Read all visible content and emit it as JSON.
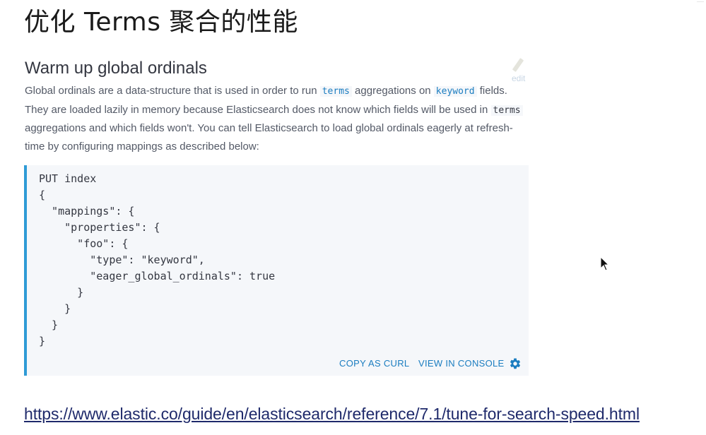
{
  "slide": {
    "title": "优化 Terms 聚合的性能"
  },
  "doc": {
    "heading": "Warm up global ordinals",
    "edit_label": "edit",
    "paragraph": {
      "p1": "Global ordinals are a data-structure that is used in order to run ",
      "code_terms_link": "terms",
      "p2": " aggregations on ",
      "code_keyword_link": "keyword",
      "p3": " fields. They are loaded lazily in memory because Elasticsearch does not know which fields will be used in ",
      "code_terms": "terms",
      "p4": " aggregations and which fields won't. You can tell Elasticsearch to load global ordinals eagerly at refresh-time by configuring mappings as described below:"
    },
    "code_lines": [
      "PUT index",
      "{",
      "  \"mappings\": {",
      "    \"properties\": {",
      "      \"foo\": {",
      "        \"type\": \"keyword\",",
      "        \"eager_global_ordinals\": true",
      "      }",
      "    }",
      "  }",
      "}"
    ],
    "copy_as_curl": "COPY AS CURL",
    "view_in_console": "VIEW IN CONSOLE"
  },
  "reference_url": "https://www.elastic.co/guide/en/elasticsearch/reference/7.1/tune-for-search-speed.html",
  "colors": {
    "accent": "#1b7dc0",
    "code_border": "#2f9bd6",
    "code_bg": "#f5f7fa",
    "link": "#1f2a6b"
  },
  "icons": {
    "edit": "pencil-icon",
    "settings": "gear-icon",
    "pointer": "mouse-cursor-icon"
  }
}
